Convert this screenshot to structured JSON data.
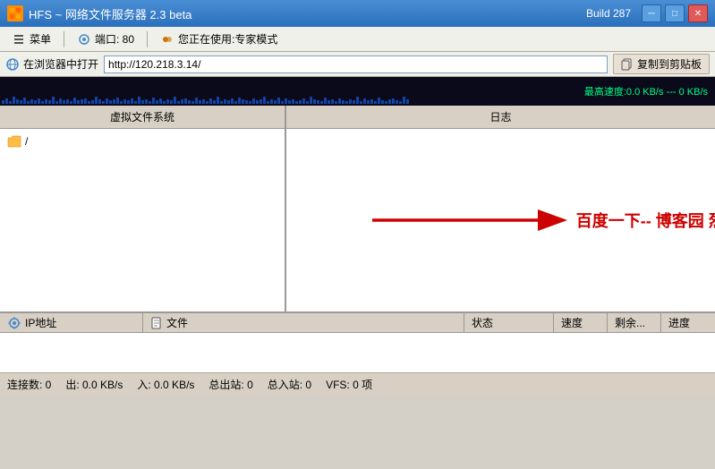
{
  "titleBar": {
    "appIcon": "HFS",
    "title": "HFS ~ 网络文件服务器 2.3 beta",
    "build": "Build 287",
    "minBtn": "─",
    "maxBtn": "□",
    "closeBtn": "✕"
  },
  "menuBar": {
    "menuLabel": "菜单",
    "portLabel": "端口: 80",
    "modeLabel": "您正在使用:专家模式"
  },
  "urlBar": {
    "openLabel": "在浏览器中打开",
    "url": "http://120.218.3.14/",
    "copyLabel": "复制到剪贴板"
  },
  "trafficBar": {
    "label": "最高速度:0.0 KB/s --- 0 KB/s"
  },
  "leftPanel": {
    "header": "虚拟文件系统",
    "rootItem": "/"
  },
  "rightPanel": {
    "header": "日志",
    "annotation": "百度一下--  博客园 烈焰病毒"
  },
  "downloadsTable": {
    "columns": [
      "IP地址",
      "文件",
      "状态",
      "速度",
      "剩余...",
      "进度"
    ]
  },
  "statusBar": {
    "connections": "连接数: 0",
    "outSpeed": "出: 0.0 KB/s",
    "inSpeed": "入: 0.0 KB/s",
    "totalOut": "总出站: 0",
    "totalIn": "总入站: 0",
    "vfs": "VFS: 0 项"
  }
}
